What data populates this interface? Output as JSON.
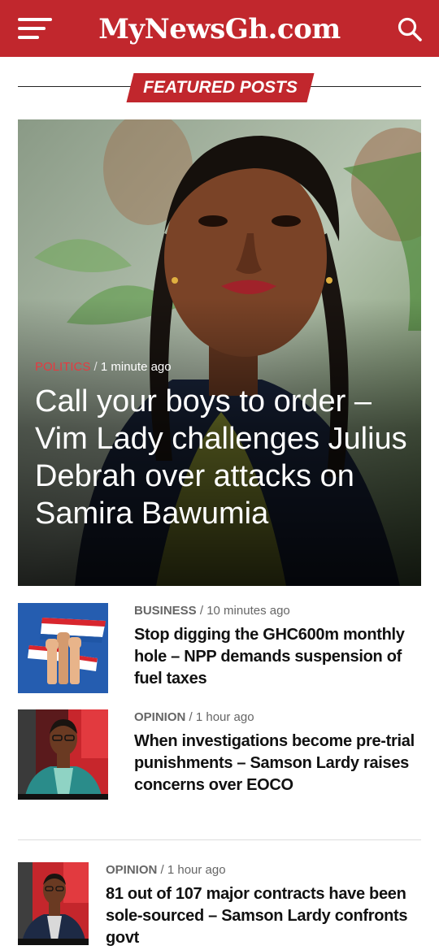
{
  "header": {
    "logo_text": "MyNewsGh.com",
    "menu_icon": "hamburger-menu-icon",
    "search_icon": "search-icon",
    "brand_color": "#c1272d"
  },
  "featured": {
    "label": "FEATURED POSTS",
    "hero": {
      "category": "POLITICS",
      "separator": "/",
      "time": "1 minute ago",
      "title": "Call your boys to order – Vim Lady challenges Julius Debrah over attacks on Samira Bawumia"
    }
  },
  "posts": [
    {
      "category": "BUSINESS",
      "separator": "/",
      "time": "10 minutes ago",
      "title": "Stop digging the GHC600m monthly hole – NPP demands suspension of fuel taxes"
    },
    {
      "category": "OPINION",
      "separator": "/",
      "time": "1 hour ago",
      "title": "When investigations become pre-trial punishments – Samson Lardy raises concerns over EOCO"
    },
    {
      "category": "OPINION",
      "separator": "/",
      "time": "1 hour ago",
      "title": "81 out of 107 major contracts have been sole-sourced – Samson Lardy confronts govt"
    }
  ],
  "colors": {
    "accent": "#c1272d",
    "category_red": "#e53a40",
    "meta_gray": "#666666"
  }
}
